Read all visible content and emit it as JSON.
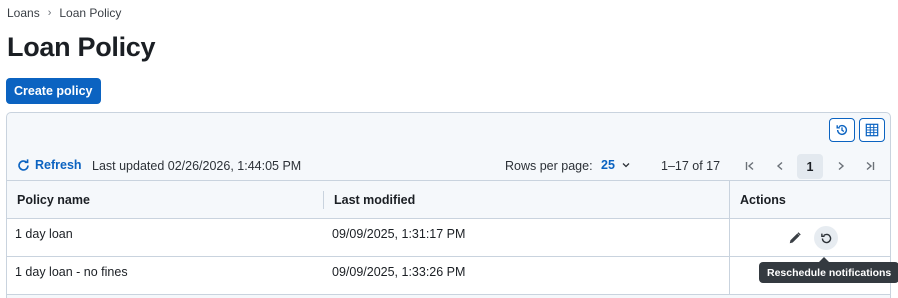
{
  "breadcrumb": {
    "items": [
      "Loans",
      "Loan Policy"
    ],
    "separator": "›"
  },
  "page": {
    "title": "Loan Policy"
  },
  "actions": {
    "create_label": "Create policy"
  },
  "toolbar": {
    "refresh_label": "Refresh",
    "last_updated": "Last updated 02/26/2026, 1:44:05 PM",
    "rows_per_page_label": "Rows per page:",
    "rows_per_page_value": "25",
    "range": "1–17 of 17",
    "current_page": "1",
    "icons": [
      "history-icon",
      "columns-icon",
      "refresh-icon",
      "first-page-icon",
      "prev-page-icon",
      "next-page-icon",
      "last-page-icon"
    ]
  },
  "table": {
    "columns": [
      "Policy name",
      "Last modified",
      "Actions"
    ],
    "rows": [
      {
        "name": "1 day loan",
        "modified": "09/09/2025, 1:31:17 PM"
      },
      {
        "name": "1 day loan - no fines",
        "modified": "09/09/2025, 1:33:26 PM"
      }
    ]
  },
  "tooltip": {
    "text": "Reschedule notifications"
  },
  "colors": {
    "accent": "#0b63c1",
    "border": "#c9d3de",
    "panel_bg": "#f5f8fb",
    "tooltip_bg": "#343a40"
  }
}
